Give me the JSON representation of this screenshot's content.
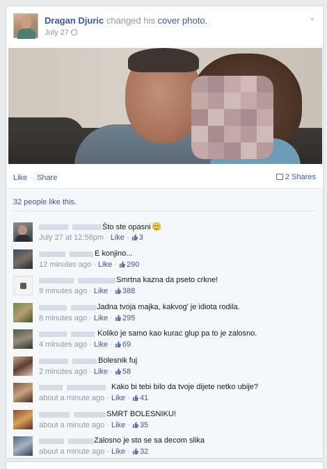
{
  "post": {
    "author": "Dragan Djuric",
    "action": "changed his",
    "object_link": "cover photo.",
    "date": "July 27",
    "privacy_icon": "globe-icon",
    "menu_icon": "chevron-down-icon"
  },
  "actions": {
    "like": "Like",
    "share": "Share",
    "separator": "·",
    "shares_label": "2 Shares",
    "shares_icon": "share-icon"
  },
  "likes_summary": "32 people like this.",
  "comments": [
    {
      "text": "Što ste opasni",
      "emoji": "smiley-icon",
      "time": "July 27 at 12:56pm",
      "like": "Like",
      "count": "3"
    },
    {
      "text": "E konjino...",
      "time": "12 minutes ago",
      "like": "Like",
      "count": "290"
    },
    {
      "text": "Smrtna kazna da pseto crkne!",
      "time": "9 minutes ago",
      "like": "Like",
      "count": "388"
    },
    {
      "text": "Jadna tvoja majka, kakvog' je idiota rodila.",
      "time": "8 minutes ago",
      "like": "Like",
      "count": "295"
    },
    {
      "text": "Koliko je samo kao kurac glup pa to je zalosno.",
      "time": "4 minutes ago",
      "like": "Like",
      "count": "69"
    },
    {
      "text": "Bolesnik fuj",
      "time": "2 minutes ago",
      "like": "Like",
      "count": "58"
    },
    {
      "text": "Kako bi tebi bilo da tvoje dijete netko ubije?",
      "time": "about a minute ago",
      "like": "Like",
      "count": "41"
    },
    {
      "text": "SMRT BOLESNIKU!",
      "time": "about a minute ago",
      "like": "Like",
      "count": "35"
    },
    {
      "text": "Zalosno je sto se sa decom slika",
      "time": "about a minute ago",
      "like": "Like",
      "count": "32"
    }
  ],
  "colors": {
    "link": "#3b5998",
    "meta": "#9197a3",
    "ufi_background": "#f6f7f9"
  }
}
